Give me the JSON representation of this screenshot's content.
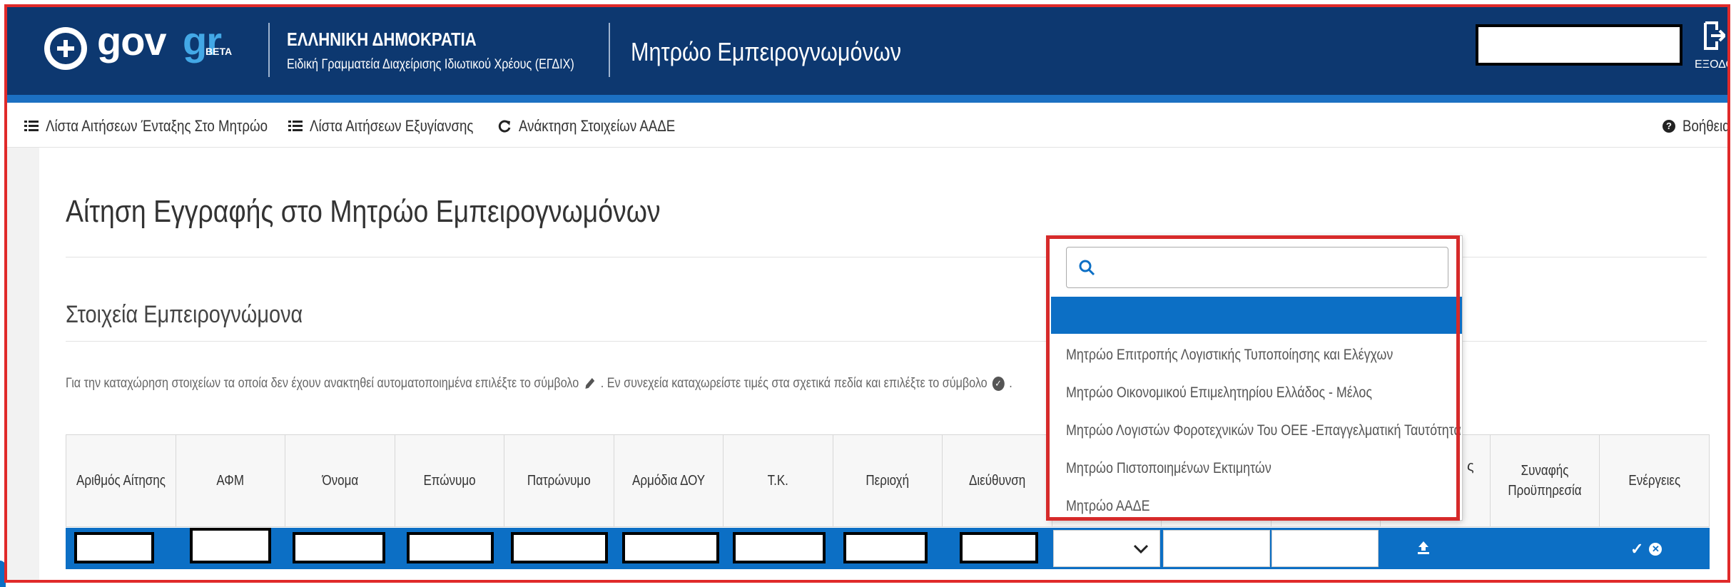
{
  "header": {
    "logo_text_gov": "gov",
    "logo_text_gr": "gr",
    "logo_beta": "BETA",
    "gov_title": "ΕΛΛΗΝΙΚΗ ΔΗΜΟΚΡΑΤΙΑ",
    "gov_subtitle": "Ειδική Γραμματεία Διαχείρισης Ιδιωτικού Χρέους (ΕΓΔΙΧ)",
    "app_title": "Μητρώο Εμπειρογνωμόνων",
    "logout_label": "ΕΞΟΔΟΣ"
  },
  "nav": {
    "items": [
      {
        "label": "Λίστα Αιτήσεων Ένταξης Στο Μητρώο",
        "icon": "list-icon"
      },
      {
        "label": "Λίστα Αιτήσεων Εξυγίανσης",
        "icon": "list-icon"
      },
      {
        "label": "Ανάκτηση Στοιχείων ΑΑΔΕ",
        "icon": "refresh-icon"
      }
    ],
    "help_label": "Βοήθεια"
  },
  "main": {
    "page_title": "Αίτηση Εγγραφής στο Μητρώο Εμπειρογνωμόνων",
    "section_title": "Στοιχεία Εμπειρογνώμονα",
    "instructions_part1": "Για την καταχώρηση στοιχείων τα οποία δεν έχουν ανακτηθεί αυτοματοποιημένα επιλέξτε το σύμβολο",
    "instructions_part2": ". Εν συνεχεία καταχωρείστε τιμές στα σχετικά πεδία και επιλέξτε το σύμβολο",
    "instructions_part3": "."
  },
  "table": {
    "headers": [
      "Αριθμός Αίτησης",
      "ΑΦΜ",
      "Όνομα",
      "Επώνυμο",
      "Πατρώνυμο",
      "Αρμόδια ΔΟΥ",
      "Τ.Κ.",
      "Περιοχή",
      "Διεύθυνση",
      "Συναφής Προϋπηρεσία",
      "Ενέργειες"
    ],
    "hidden_header_fragment": "ς"
  },
  "dropdown": {
    "search_placeholder": "",
    "options": [
      "Μητρώο Επιτροπής Λογιστικής Τυποποίησης και Ελέγχων",
      "Μητρώο Οικονομικού Επιμελητηρίου Ελλάδος - Μέλος",
      "Μητρώο Λογιστών Φοροτεχνικών Του ΟΕΕ -Επαγγελματική Ταυτότητα",
      "Μητρώο Πιστοποιημένων Εκτιμητών",
      "Μητρώο ΑΑΔΕ"
    ]
  },
  "colors": {
    "header_bg": "#0d3870",
    "accent_blue": "#0c6fc5",
    "highlight_red": "#d62a2a"
  }
}
